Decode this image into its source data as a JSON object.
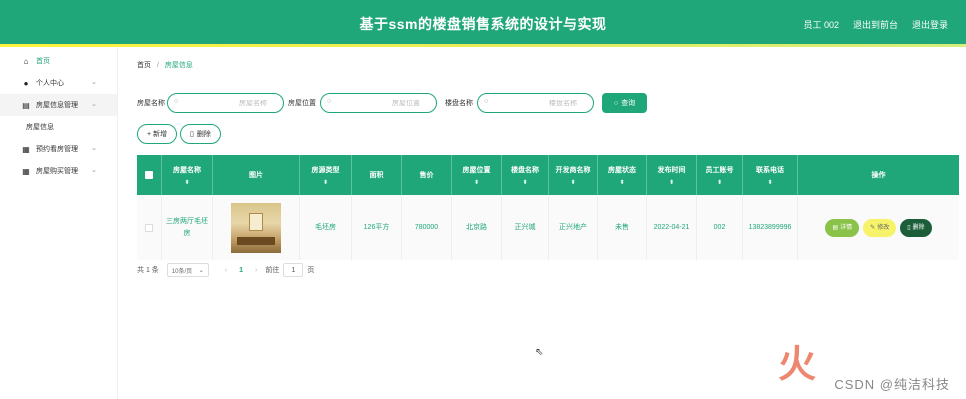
{
  "header": {
    "title": "基于ssm的楼盘销售系统的设计与实现",
    "user": "员工 002",
    "back_to_front": "退出到前台",
    "logout": "退出登录"
  },
  "sidebar": {
    "items": [
      {
        "label": "首页",
        "icon": "home-icon"
      },
      {
        "label": "个人中心",
        "icon": "user-icon"
      },
      {
        "label": "房屋信息管理",
        "icon": "list-icon"
      },
      {
        "label": "房屋信息",
        "icon": ""
      },
      {
        "label": "预约看房管理",
        "icon": "grid-icon"
      },
      {
        "label": "房屋购买管理",
        "icon": "grid-icon"
      }
    ]
  },
  "breadcrumb": {
    "home": "首页",
    "sep": "/",
    "current": "房屋信息"
  },
  "search": {
    "house_name_label": "房屋名称",
    "house_name_placeholder": "房屋名称",
    "house_location_label": "房屋位置",
    "house_location_placeholder": "房屋位置",
    "building_name_label": "楼盘名称",
    "building_name_placeholder": "楼盘名称",
    "button": "查询"
  },
  "actions": {
    "add": "+ 新增",
    "delete": "删除"
  },
  "table": {
    "headers": [
      "房屋名称",
      "图片",
      "房源类型",
      "面积",
      "售价",
      "房屋位置",
      "楼盘名称",
      "开发商名称",
      "房屋状态",
      "发布时间",
      "员工账号",
      "联系电话",
      "操作"
    ],
    "rows": [
      {
        "name": "三房两厅毛坯房",
        "type": "毛坯房",
        "area": "126平方",
        "price": "780000",
        "location": "北京路",
        "building": "正兴城",
        "developer": "正兴地产",
        "status": "未售",
        "date": "2022-04-21",
        "staff": "002",
        "phone": "13823899996"
      }
    ],
    "ops": {
      "detail": "详情",
      "edit": "修改",
      "delete": "删除"
    }
  },
  "pagination": {
    "total": "共 1 条",
    "page_size": "10条/页",
    "current": "1",
    "goto": "前往",
    "page_input": "1",
    "page_suffix": "页"
  },
  "watermark": {
    "text": "CSDN @纯洁科技"
  }
}
